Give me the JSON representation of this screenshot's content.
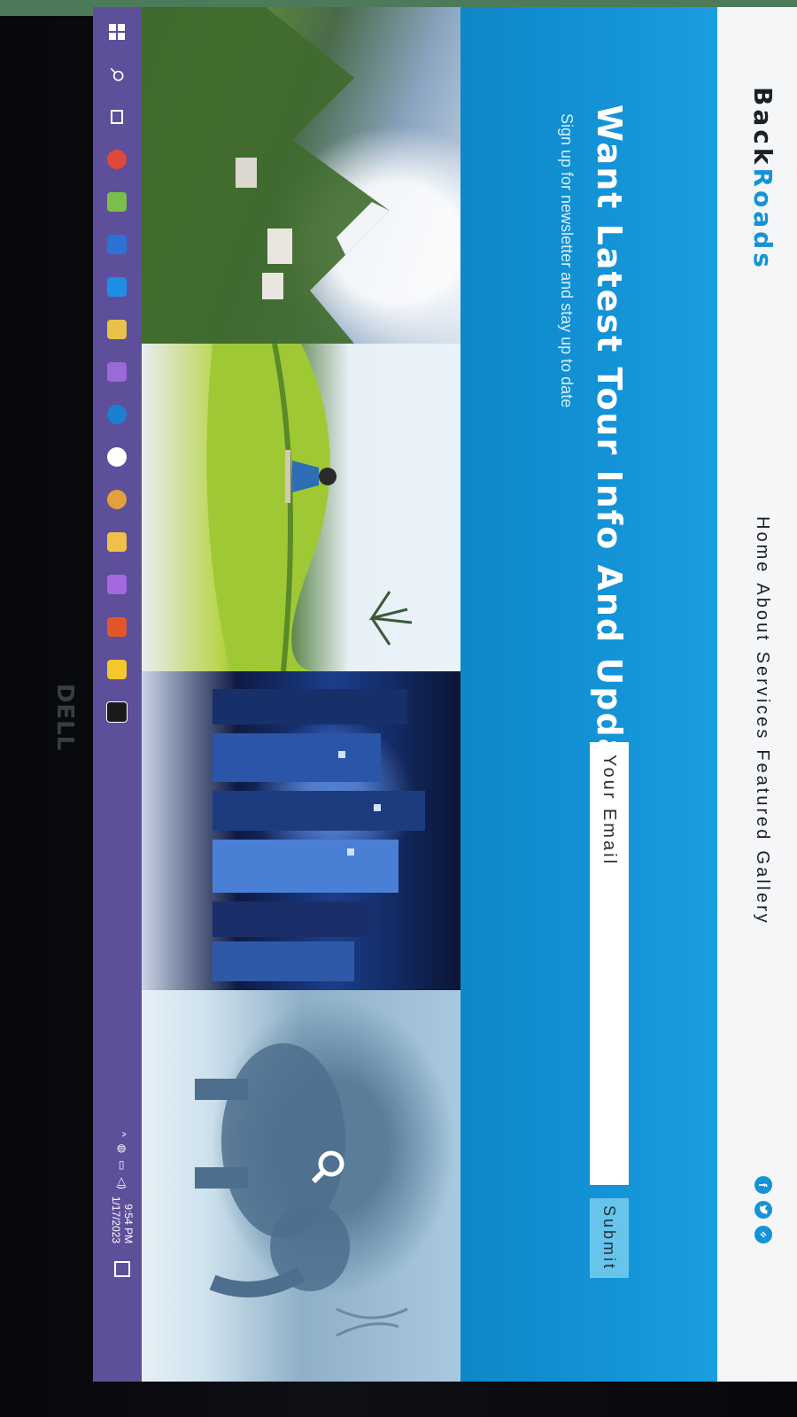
{
  "brand": {
    "part1": "Back",
    "part2": "Roads",
    "accent": "#1593d6"
  },
  "nav": {
    "links": [
      {
        "label": "Home"
      },
      {
        "label": "About"
      },
      {
        "label": "Services"
      },
      {
        "label": "Featured"
      },
      {
        "label": "Gallery"
      }
    ]
  },
  "social": [
    {
      "icon": "facebook-icon",
      "glyph": "f"
    },
    {
      "icon": "twitter-icon",
      "glyph": "t"
    },
    {
      "icon": "squarespace-icon",
      "glyph": "s"
    }
  ],
  "hero": {
    "headline": "Want Latest Tour Info And Updates?",
    "subline": "Sign up for newsletter and stay up to date",
    "email_placeholder": "Your Email",
    "submit_label": "Submit",
    "background": "#1a9ee0"
  },
  "gallery": {
    "tiles": [
      {
        "icon": "mountain-village-photo"
      },
      {
        "icon": "rice-terrace-yoga-photo"
      },
      {
        "icon": "city-night-skyline-photo"
      },
      {
        "icon": "elephant-photo"
      }
    ],
    "hover_icon": "search-icon"
  },
  "taskbar": {
    "icons": [
      "windows-start-icon",
      "search-icon",
      "task-view-icon",
      "chrome-icon",
      "photos-icon",
      "outlook-icon",
      "visual-studio-icon",
      "explorer-icon",
      "visual-studio-purple-icon",
      "edge-icon",
      "app-icon",
      "slack-icon",
      "folder-icon",
      "visual-studio-icon-2",
      "office-icon",
      "sticky-notes-icon",
      "terminal-icon"
    ],
    "time": "9:54 PM",
    "date": "1/17/2023"
  },
  "device": {
    "logo": "DELL"
  }
}
